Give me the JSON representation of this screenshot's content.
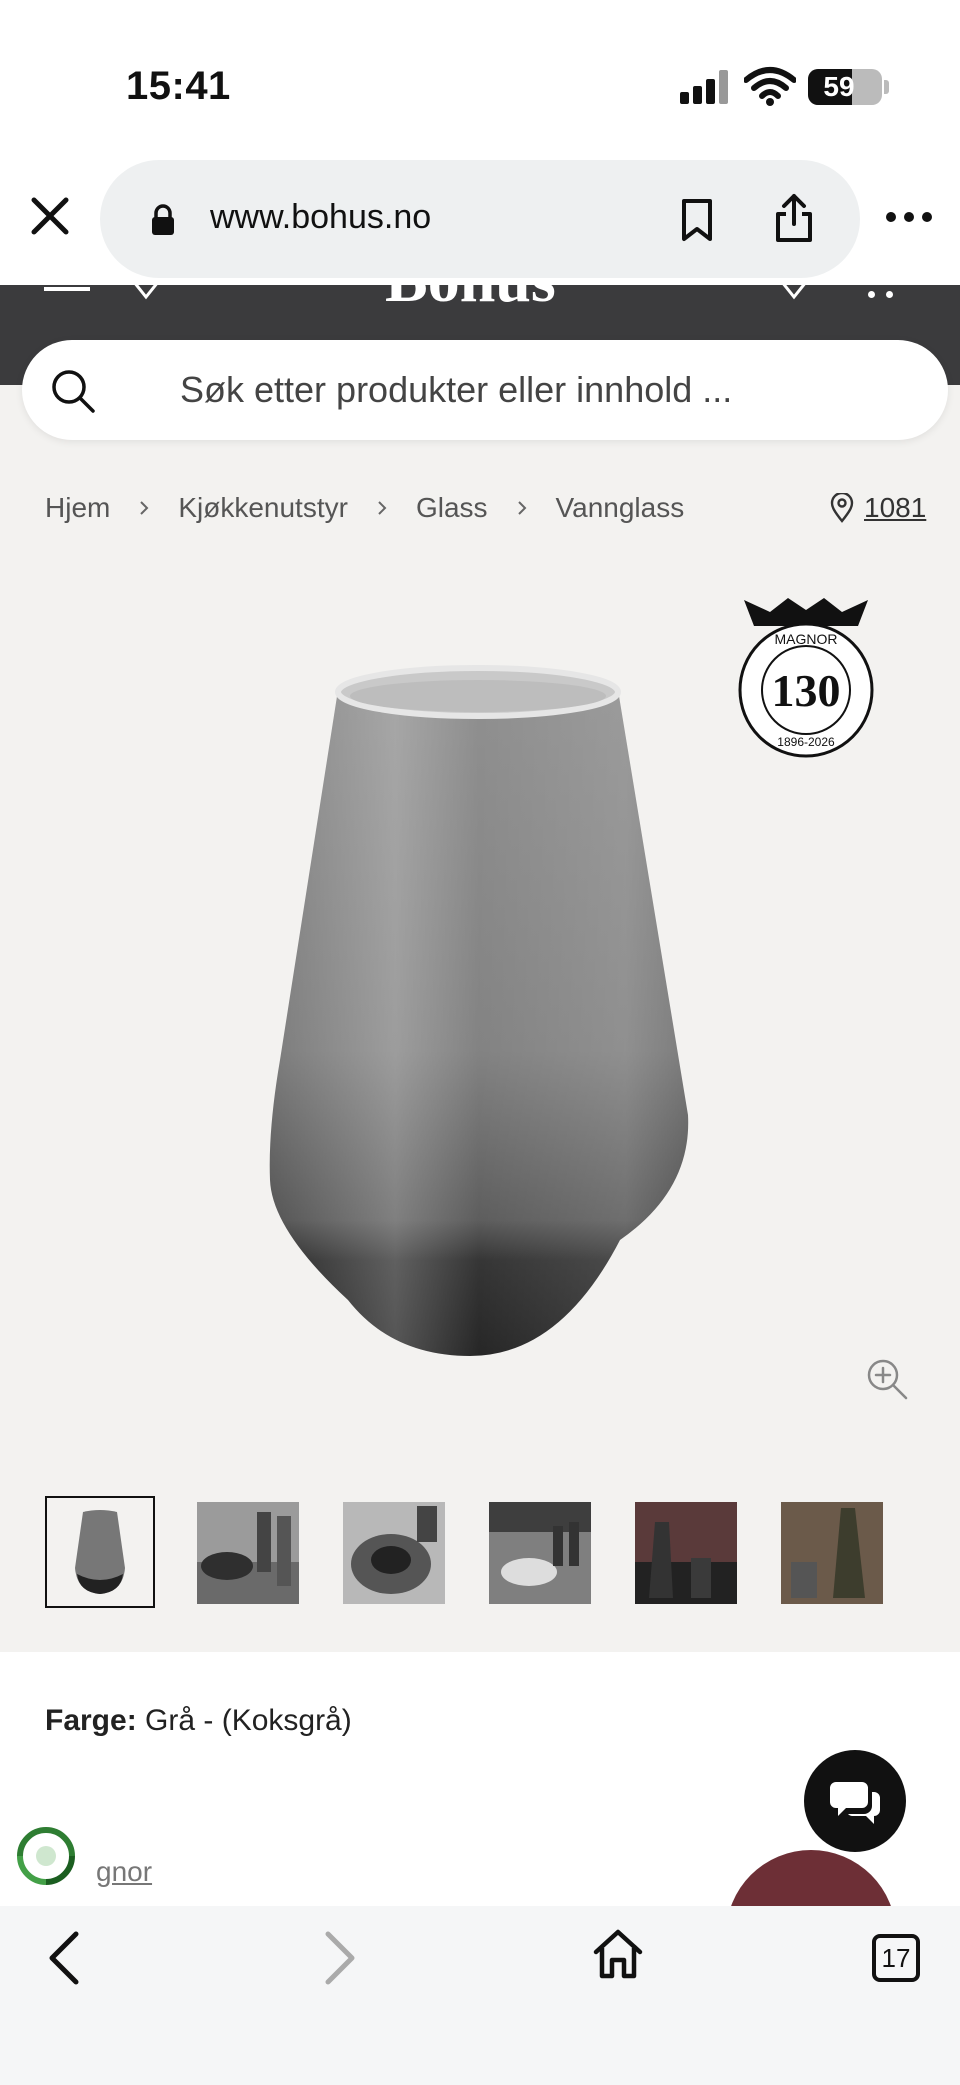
{
  "status_bar": {
    "time": "15:41",
    "battery": "59",
    "battery_level": 0.59
  },
  "browser": {
    "url": "www.bohus.no",
    "tabs_count": "17"
  },
  "site": {
    "logo": "Bohus"
  },
  "search": {
    "placeholder": "Søk etter produkter eller innhold ..."
  },
  "breadcrumb": {
    "items": [
      "Hjem",
      "Kjøkkenutstyr",
      "Glass",
      "Vannglass"
    ]
  },
  "store": {
    "code": "1081"
  },
  "badge": {
    "brand": "MAGNOR",
    "number": "130",
    "years": "1896-2026"
  },
  "thumbnails": {
    "count": 6,
    "selected_index": 0
  },
  "product": {
    "color_label": "Farge:",
    "color_value": "Grå - (Koksgrå)",
    "brand_partial": "gnor"
  },
  "icons": {
    "close": "close-icon",
    "lock": "lock-icon",
    "bookmark": "bookmark-icon",
    "share": "share-icon",
    "more": "more-icon",
    "search": "search-icon",
    "chevron": "chevron-right-icon",
    "pin": "location-pin-icon",
    "zoom": "zoom-in-icon",
    "chat": "chat-icon",
    "eco": "recycle-icon",
    "back": "back-icon",
    "forward": "forward-icon",
    "home": "home-icon",
    "tabs": "tabs-icon"
  },
  "colors": {
    "header_bg": "#3b3b3d",
    "page_bg": "#f3f2f0",
    "promo": "#6d2f36"
  }
}
